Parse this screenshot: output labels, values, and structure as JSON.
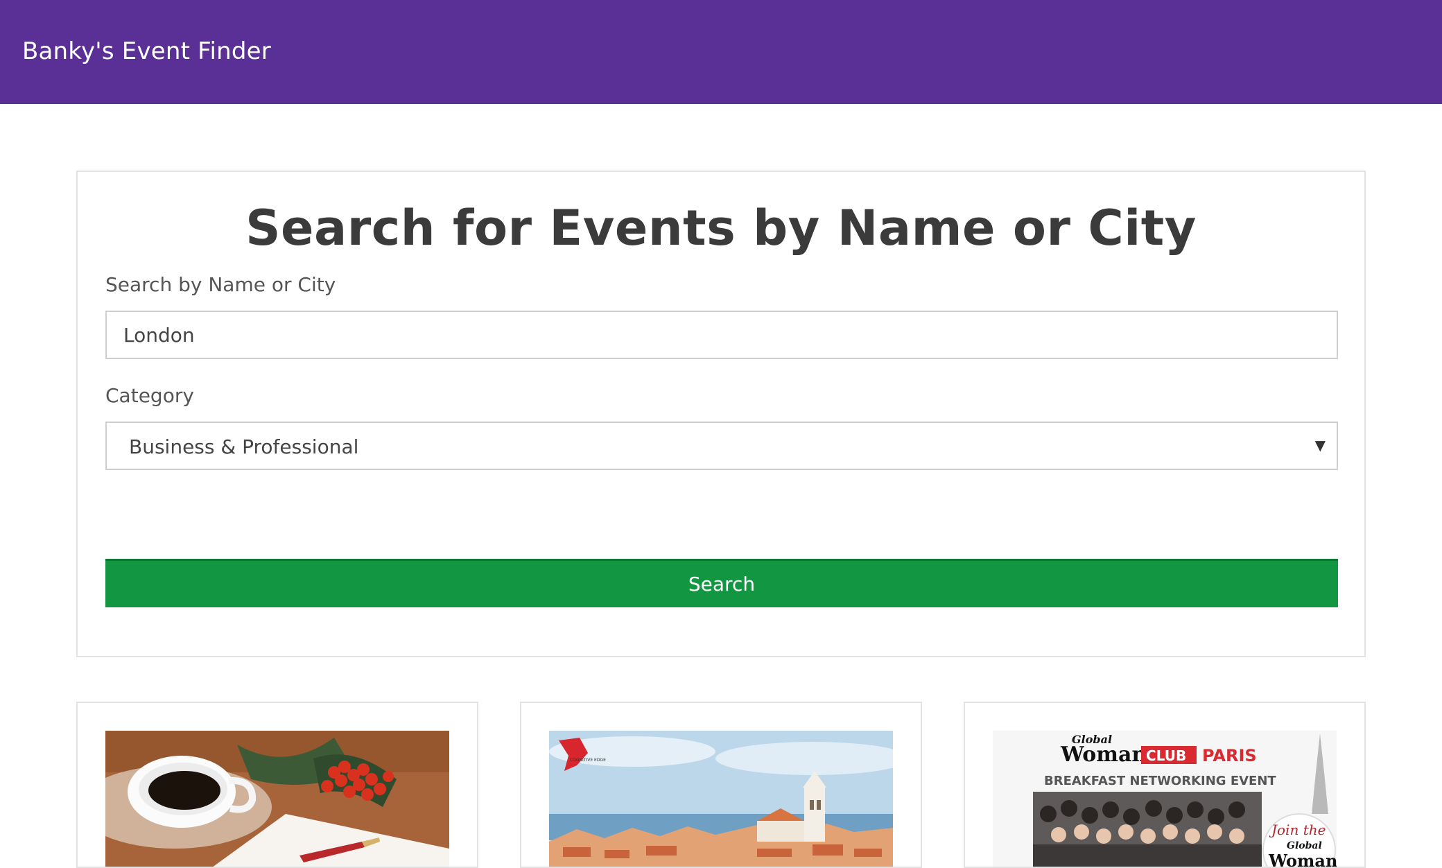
{
  "navbar": {
    "brand": "Banky's Event Finder"
  },
  "search": {
    "title": "Search for Events by Name or City",
    "name_label": "Search by Name or City",
    "name_value": "London",
    "category_label": "Category",
    "category_value": "Business & Professional",
    "button_label": "Search"
  },
  "events": [
    {
      "image_icon": "coffee-cup-icon"
    },
    {
      "image_logo_text": "COGNITIVE EDGE",
      "image_icon": "city-harbor-icon"
    },
    {
      "image_text": {
        "global": "Global",
        "woman": "Woman",
        "club": "CLUB",
        "paris": "PARIS",
        "subtitle": "BREAKFAST NETWORKING EVENT",
        "join": "Join the"
      }
    }
  ],
  "colors": {
    "navbar": "#5a3096",
    "button": "#129642",
    "border": "#e2e2e2"
  }
}
